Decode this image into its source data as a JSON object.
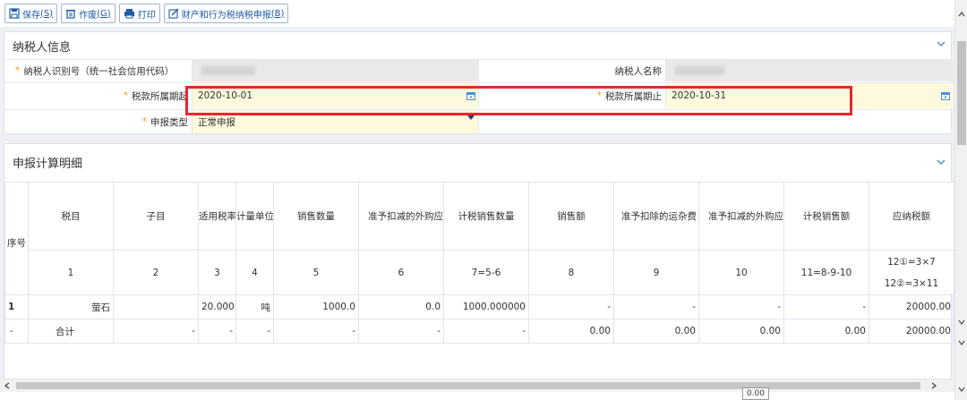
{
  "toolbar": {
    "save_label": "保存",
    "save_key": "(S)",
    "void_label": "作废",
    "void_key": "(G)",
    "print_label": "打印",
    "report_label": "财产和行为税纳税申报",
    "report_key": "(B)"
  },
  "taxpayer": {
    "section_title": "纳税人信息",
    "id_label": "纳税人识别号（统一社会信用代码）",
    "name_label": "纳税人名称",
    "period_start_label": "税款所属期起",
    "period_start_value": "2020-10-01",
    "period_end_label": "税款所属期止",
    "period_end_value": "2020-10-31",
    "report_type_label": "申报类型",
    "report_type_value": "正常申报"
  },
  "detail": {
    "section_title": "申报计算明细",
    "headers": [
      "序号",
      "税目",
      "子目",
      "适用税率",
      "计量单位",
      "销售数量",
      "准予扣减的外购应税产品购进数量",
      "计税销售数量",
      "销售额",
      "准予扣除的运杂费",
      "准予扣减的外购应税产品购进金额",
      "计税销售额",
      "应纳税额"
    ],
    "col_numbers": [
      "1",
      "2",
      "3",
      "4",
      "5",
      "6",
      "7=5-6",
      "8",
      "9",
      "10",
      "11=8-9-10",
      "12①=3×7",
      "12②=3×11"
    ],
    "row1": {
      "seq": "1",
      "tax_item": "萤石",
      "sub_item": "",
      "rate": "20.000...",
      "unit": "吨",
      "sales_qty": "1000.0",
      "deduct_qty": "0.0",
      "taxable_qty": "1000.000000",
      "sales_amt": "-",
      "freight": "-",
      "deduct_amt": "-",
      "taxable_amt": "-",
      "tax_due": "20000.00"
    },
    "total": {
      "seq": "-",
      "label": "合计",
      "sub_item": "-",
      "rate": "-",
      "unit": "-",
      "sales_qty": "-",
      "deduct_qty": "-",
      "taxable_qty": "-",
      "sales_amt": "0.00",
      "freight": "0.00",
      "deduct_amt": "0.00",
      "taxable_amt": "0.00",
      "tax_due": "20000.00"
    }
  },
  "tooltip_value": "0.00",
  "colors": {
    "accent": "#1e5aa8",
    "required_star": "#f39a1e",
    "highlight_border": "#e8262e",
    "editable_bg": "#fdf9dc"
  }
}
